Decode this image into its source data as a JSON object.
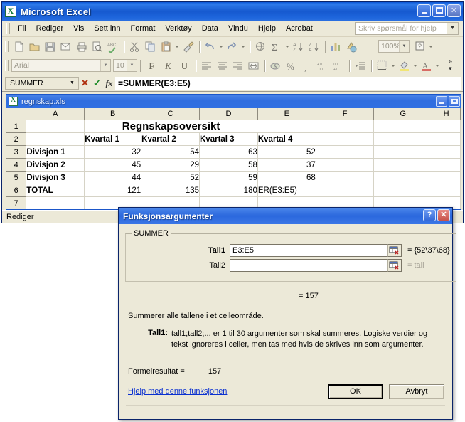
{
  "app": {
    "title": "Microsoft Excel",
    "logo_icon": "excel-logo-icon",
    "window_buttons": {
      "minimize": "minimize-icon",
      "maximize": "maximize-icon",
      "close": "close-icon"
    }
  },
  "menubar": {
    "items": [
      {
        "label": "Fil",
        "accel": "F"
      },
      {
        "label": "Rediger",
        "accel": "R"
      },
      {
        "label": "Vis",
        "accel": "V"
      },
      {
        "label": "Sett inn",
        "accel": "i"
      },
      {
        "label": "Format",
        "accel": "o"
      },
      {
        "label": "Verktøy",
        "accel": "k"
      },
      {
        "label": "Data",
        "accel": "D"
      },
      {
        "label": "Vindu",
        "accel": "n"
      },
      {
        "label": "Hjelp",
        "accel": "H"
      },
      {
        "label": "Acrobat",
        "accel": "b"
      }
    ],
    "ask_box_placeholder": "Skriv spørsmål for hjelp"
  },
  "standard_toolbar": {
    "zoom_value": "100%",
    "buttons": [
      "new-document-icon",
      "open-folder-icon",
      "save-disk-icon",
      "email-icon",
      "print-icon",
      "print-preview-icon",
      "spelling-check-icon",
      "cut-scissors-icon",
      "copy-icon",
      "paste-clipboard-icon",
      "format-painter-icon",
      "undo-arrow-icon",
      "redo-arrow-icon",
      "insert-hyperlink-icon",
      "autosum-sigma-icon",
      "sort-ascending-icon",
      "sort-descending-icon",
      "chart-wizard-icon",
      "drawing-icon",
      "help-question-icon"
    ]
  },
  "formatting_toolbar": {
    "font_name": "Arial",
    "font_size": "10",
    "bold_label": "F",
    "italic_label": "K",
    "underline_label": "U",
    "buttons": [
      "align-left-icon",
      "align-center-icon",
      "align-right-icon",
      "merge-center-icon",
      "currency-icon",
      "percent-icon",
      "comma-icon",
      "increase-decimal-icon",
      "decrease-decimal-icon",
      "indent-icon",
      "borders-icon",
      "fill-color-icon",
      "font-color-icon",
      "more-buttons-icon"
    ]
  },
  "formula_bar": {
    "name_box": "SUMMER",
    "cancel_icon": "cancel-x-icon",
    "enter_icon": "confirm-check-icon",
    "function_icon": "insert-function-fx-icon",
    "formula": "=SUMMER(E3:E5)"
  },
  "document_window": {
    "title": "regnskap.xls",
    "logo_icon": "workbook-icon",
    "minimize": "minimize-icon",
    "maximize": "maximize-icon"
  },
  "sheet": {
    "column_headers": [
      "A",
      "B",
      "C",
      "D",
      "E",
      "F",
      "G",
      "H"
    ],
    "row_headers": [
      "1",
      "2",
      "3",
      "4",
      "5",
      "6",
      "7"
    ],
    "rows": [
      {
        "num": "1",
        "cells": [
          "",
          "Regnskapsoversikt",
          "",
          "",
          "",
          "",
          "",
          ""
        ]
      },
      {
        "num": "2",
        "cells": [
          "",
          "Kvartal 1",
          "Kvartal 2",
          "Kvartal 3",
          "Kvartal 4",
          "",
          "",
          ""
        ]
      },
      {
        "num": "3",
        "cells": [
          "Divisjon 1",
          "32",
          "54",
          "63",
          "52",
          "",
          "",
          ""
        ]
      },
      {
        "num": "4",
        "cells": [
          "Divisjon 2",
          "45",
          "29",
          "58",
          "37",
          "",
          "",
          ""
        ]
      },
      {
        "num": "5",
        "cells": [
          "Divisjon 3",
          "44",
          "52",
          "59",
          "68",
          "",
          "",
          ""
        ]
      },
      {
        "num": "6",
        "cells": [
          "TOTAL",
          "121",
          "135",
          "180",
          "ER(E3:E5)",
          "",
          "",
          ""
        ]
      },
      {
        "num": "7",
        "cells": [
          "",
          "",
          "",
          "",
          "",
          "",
          "",
          ""
        ]
      }
    ]
  },
  "status_bar": {
    "text": "Rediger"
  },
  "dialog": {
    "title": "Funksjonsargumenter",
    "help_button": "?",
    "close_button": "✕",
    "group_label": "SUMMER",
    "args": [
      {
        "label": "Tall1",
        "value": "E3:E5",
        "result": "= {52\\37\\68}",
        "bold": true,
        "gray": false,
        "collapse_icon": "range-selector-icon"
      },
      {
        "label": "Tall2",
        "value": "",
        "result": "= tall",
        "bold": false,
        "gray": true,
        "collapse_icon": "range-selector-icon"
      }
    ],
    "interim_result": "= 157",
    "description": "Summerer alle tallene i et celleområde.",
    "arg_help_name": "Tall1:",
    "arg_help_text": "tall1;tall2;... er 1 til 30 argumenter som skal summeres. Logiske verdier og tekst ignoreres i celler, men tas med hvis de skrives inn som argumenter.",
    "formula_result_label": "Formelresultat =",
    "formula_result_value": "157",
    "help_link": "Hjelp med denne funksjonen",
    "ok_label": "OK",
    "cancel_label": "Avbryt"
  },
  "colors": {
    "titlebar_blue": "#1659cf",
    "dialog_blue": "#2b68dd",
    "face": "#ece9d8",
    "link": "#0a30d0",
    "grid_line": "#d6d3c6"
  }
}
